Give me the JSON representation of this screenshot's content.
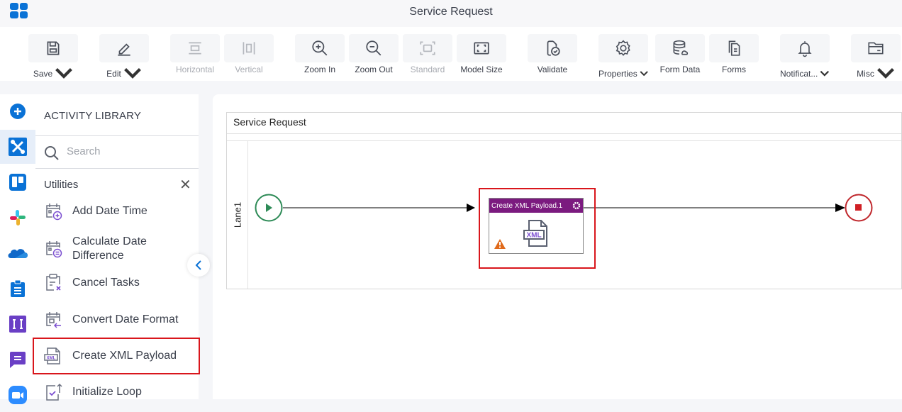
{
  "app": {
    "title": "Service Request"
  },
  "toolbar": {
    "save": "Save",
    "edit": "Edit",
    "horizontal": "Horizontal",
    "vertical": "Vertical",
    "zoom_in": "Zoom In",
    "zoom_out": "Zoom Out",
    "standard": "Standard",
    "model_size": "Model Size",
    "validate": "Validate",
    "properties": "Properties",
    "form_data": "Form Data",
    "forms": "Forms",
    "notifications": "Notificat...",
    "misc": "Misc"
  },
  "rail": {
    "items": [
      "add",
      "utilities",
      "trello",
      "slack",
      "onedrive",
      "tasks",
      "document",
      "chat",
      "zoom"
    ]
  },
  "library": {
    "title": "ACTIVITY LIBRARY",
    "search_placeholder": "Search",
    "category": "Utilities",
    "items": [
      {
        "label": "Add Date Time",
        "icon": "calendar-plus"
      },
      {
        "label": "Calculate Date Difference",
        "icon": "calendar-equals"
      },
      {
        "label": "Cancel Tasks",
        "icon": "clipboard-x"
      },
      {
        "label": "Convert Date Format",
        "icon": "calendar-arrow"
      },
      {
        "label": "Create XML Payload",
        "icon": "xml-file",
        "selected": true
      },
      {
        "label": "Initialize Loop",
        "icon": "loop-check"
      }
    ]
  },
  "canvas": {
    "pool_title": "Service Request",
    "lane": "Lane1",
    "task": {
      "title": "Create XML Payload.1",
      "icon_text": "XML",
      "warning": true
    }
  },
  "colors": {
    "accent": "#0a72d6",
    "task_header": "#7b1a7f",
    "selection": "#d9161c",
    "start": "#2e8b57",
    "end": "#c0282d",
    "warning": "#e06a1b"
  }
}
